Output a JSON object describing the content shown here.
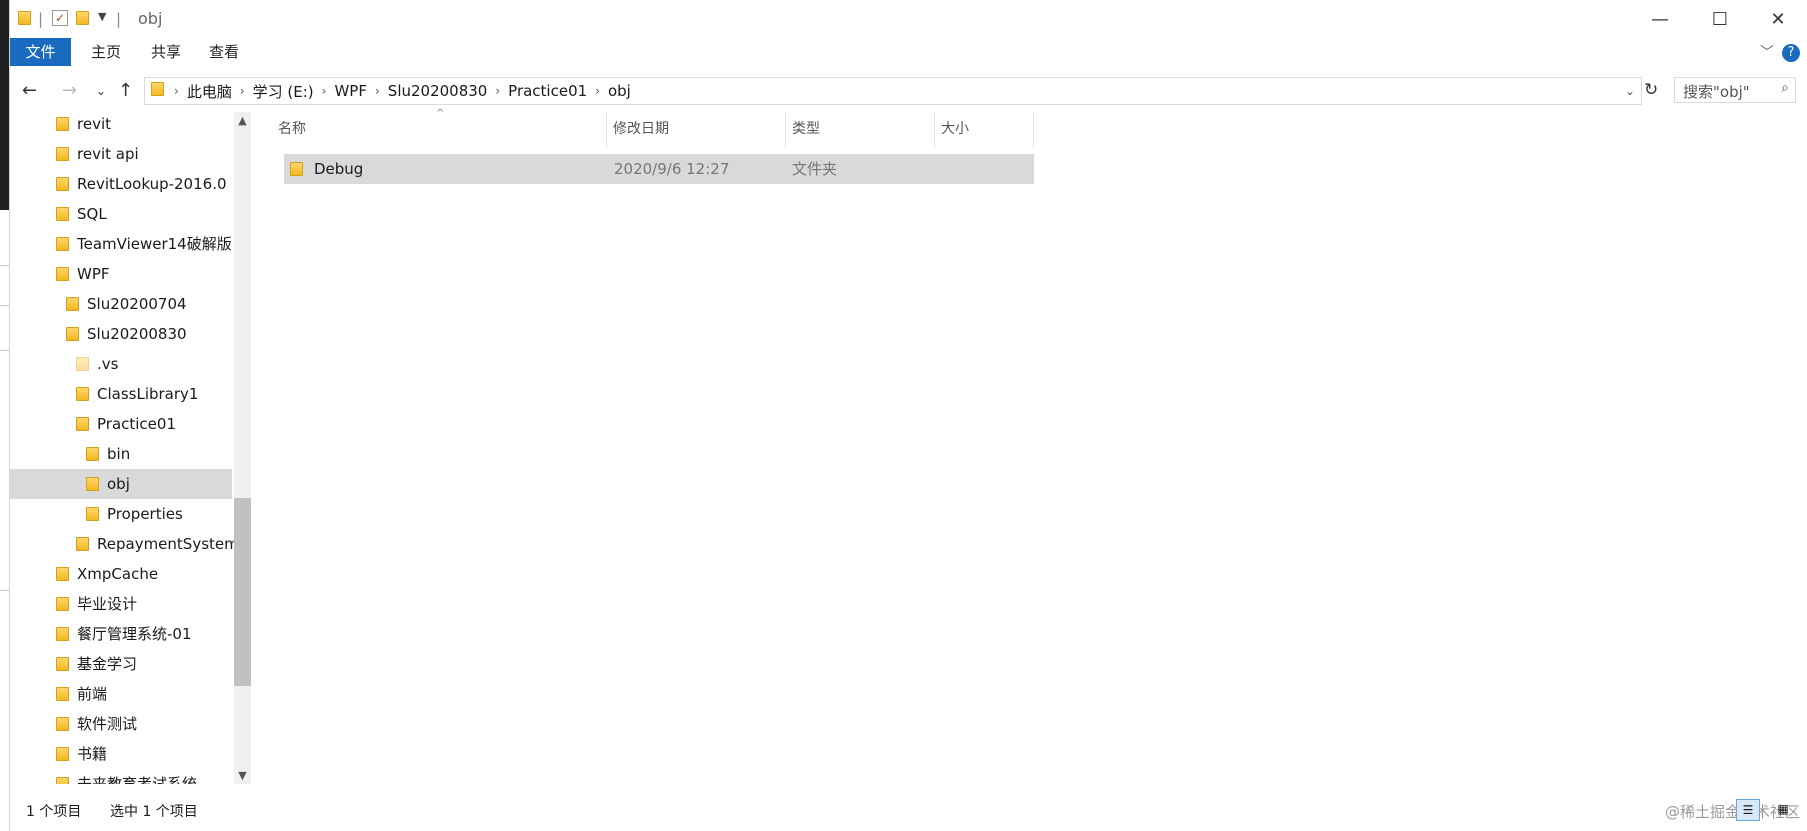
{
  "window": {
    "title": "obj"
  },
  "titlebar": {
    "separator": "|"
  },
  "ribbon": {
    "tabs": [
      {
        "label": "文件"
      },
      {
        "label": "主页"
      },
      {
        "label": "共享"
      },
      {
        "label": "查看"
      }
    ],
    "help_label": "?"
  },
  "address": {
    "crumbs": [
      "此电脑",
      "学习 (E:)",
      "WPF",
      "Slu20200830",
      "Practice01",
      "obj"
    ]
  },
  "search": {
    "placeholder": "搜索\"obj\""
  },
  "tree": {
    "items": [
      {
        "label": "revit"
      },
      {
        "label": "revit api"
      },
      {
        "label": "RevitLookup-2016.0"
      },
      {
        "label": "SQL"
      },
      {
        "label": "TeamViewer14破解版"
      },
      {
        "label": "WPF"
      },
      {
        "label": "Slu20200704"
      },
      {
        "label": "Slu20200830"
      },
      {
        "label": ".vs"
      },
      {
        "label": "ClassLibrary1"
      },
      {
        "label": "Practice01"
      },
      {
        "label": "bin"
      },
      {
        "label": "obj"
      },
      {
        "label": "Properties"
      },
      {
        "label": "RepaymentSystem"
      },
      {
        "label": "XmpCache"
      },
      {
        "label": "毕业设计"
      },
      {
        "label": "餐厅管理系统-01"
      },
      {
        "label": "基金学习"
      },
      {
        "label": "前端"
      },
      {
        "label": "软件测试"
      },
      {
        "label": "书籍"
      },
      {
        "label": "未来教育考试系统"
      }
    ]
  },
  "list": {
    "columns": [
      {
        "label": "名称"
      },
      {
        "label": "修改日期"
      },
      {
        "label": "类型"
      },
      {
        "label": "大小"
      }
    ],
    "rows": [
      {
        "name": "Debug",
        "date": "2020/9/6 12:27",
        "type": "文件夹",
        "size": ""
      }
    ]
  },
  "status": {
    "count": "1 个项目",
    "selected": "选中 1 个项目",
    "watermark": "@稀土掘金技术社区"
  },
  "colors": {
    "accent": "#1a6bbf",
    "selection": "#d9d9d9",
    "folder": "#f3b81f"
  }
}
